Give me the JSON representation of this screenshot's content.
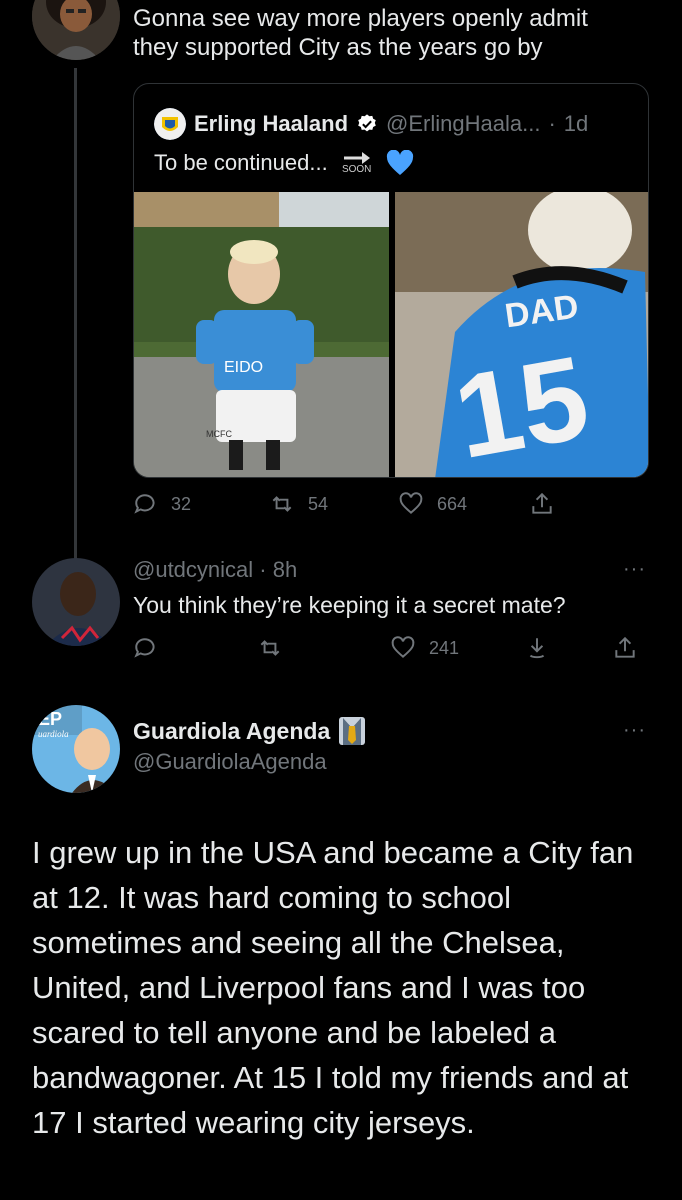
{
  "tweet1": {
    "text": "Gonna see way more players openly admit they supported City as the years go by"
  },
  "quote": {
    "name": "Erling Haaland",
    "handle": "@ErlingHaala...",
    "time": "1d",
    "text": "To be continued...",
    "soon_label": "SOON",
    "heart_emoji": "💙",
    "photo1_shirt": "EIDO",
    "photo1_shorts": "MCFC",
    "photo2_name": "DAD",
    "photo2_number": "15",
    "replies": "32",
    "retweets": "54",
    "likes": "664"
  },
  "reply": {
    "handle": "@utdcynical",
    "time": "8h",
    "text": "You think they’re keeping it a secret mate?",
    "likes": "241"
  },
  "main": {
    "name": "Guardiola Agenda",
    "handle": "@GuardiolaAgenda",
    "avatar_badge": "EP",
    "avatar_sub": "uardiola",
    "text": "I grew up in the USA and became a City fan at 12. It was hard coming to school sometimes and seeing all the Chelsea, United, and Liverpool fans and I was too scared to tell anyone and be labeled a bandwagoner. At 15 I told my friends and at 17 I started wearing city jerseys."
  },
  "more_glyph": "···",
  "colors": {
    "background": "#000000",
    "text": "#e7e9ea",
    "muted": "#71767b",
    "verified": "#ffffff",
    "city_blue": "#1e7ec8"
  }
}
